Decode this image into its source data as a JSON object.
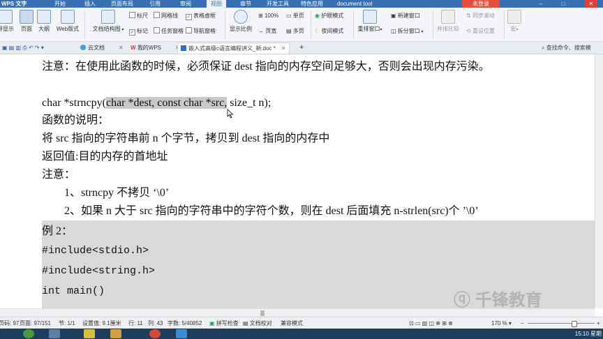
{
  "menubar": {
    "app": "WPS 文字",
    "items": [
      "开始",
      "插入",
      "页面布局",
      "引用",
      "审阅",
      "视图",
      "章节",
      "开发工具",
      "特色应用"
    ],
    "active": "视图",
    "doc_tool": "document tool",
    "login": "未登录"
  },
  "ribbon": {
    "big": [
      "屏显示",
      "页面",
      "大纲",
      "Web版式",
      "文档结构图",
      "显示比例"
    ],
    "checks": {
      "ruler": "标尺",
      "gridlines": "网格线",
      "table_grid": "表格虚框",
      "marks": "标记",
      "task_pane": "任务窗格",
      "nav_pane": "导航窗格"
    },
    "zoom_100": "100%",
    "single_page": "单页",
    "page_width": "页宽",
    "multi_page": "多页",
    "eye_mode": "护眼模式",
    "night_mode": "夜间模式",
    "rearrange": "重排窗口",
    "new_window": "新建窗口",
    "split_window": "拆分窗口",
    "side_by_side": "并排比较",
    "sync_scroll": "同步滚动",
    "reset_position": "重设位置",
    "macro": "宏"
  },
  "tabs": {
    "cloud": "云文档",
    "mywps": "我的WPS",
    "doc": "嵌入式高级c语言编程讲义_新.doc *",
    "search_placeholder": "查找命令、搜索模"
  },
  "document": {
    "note_top": "注意：在使用此函数的时候，必须保证 dest 指向的内存空间足够大，否则会出现内存污染。",
    "sig_pre": "char *strncpy(",
    "sig_hl": "char *dest, const char *src,",
    "sig_post": " size_t n);",
    "desc_title": "函数的说明：",
    "desc_line": "将 src 指向的字符串前 n 个字节，拷贝到 dest 指向的内存中",
    "ret_line": "返回值:目的内存的首地址",
    "note_title": "注意：",
    "note1": "1、strncpy 不拷贝 ‘\\0’",
    "note2": "2、如果 n 大于 src 指向的字符串中的字符个数，则在 dest 后面填充 n-strlen(src)个 ’\\0’",
    "example": "例 2：",
    "code1": "#include<stdio.h>",
    "code2": "#include<string.h>",
    "code3": "int main()"
  },
  "status": {
    "page_num": "页码: 97",
    "pages": "页面: 97/151",
    "section": "节: 1/1",
    "setting": "设置值: 9.1厘米",
    "row": "行: 11",
    "col": "列: 43",
    "words": "字数: 5/40852",
    "spell": "拼写检查",
    "proof": "文档校对",
    "compat": "兼容模式",
    "zoom": "170 %",
    "zoom_level": 0.7
  },
  "watermark": "千锋教育",
  "clock": "15:10 星期"
}
